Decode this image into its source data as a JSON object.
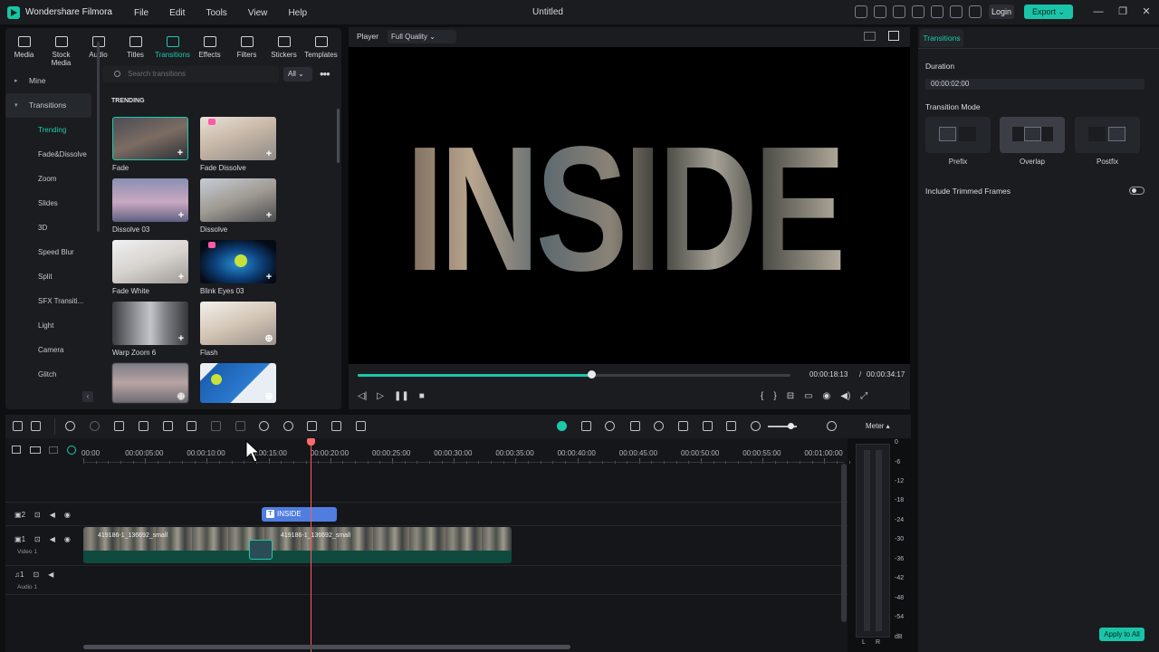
{
  "app": {
    "name": "Wondershare Filmora",
    "window_title": "Untitled",
    "login": "Login",
    "export": "Export"
  },
  "menu": [
    "File",
    "Edit",
    "Tools",
    "View",
    "Help"
  ],
  "media_tabs": [
    {
      "label": "Media",
      "icon": "media-icon"
    },
    {
      "label": "Stock Media",
      "icon": "stock-media-icon"
    },
    {
      "label": "Audio",
      "icon": "audio-icon"
    },
    {
      "label": "Titles",
      "icon": "titles-icon"
    },
    {
      "label": "Transitions",
      "icon": "transitions-icon",
      "active": true
    },
    {
      "label": "Effects",
      "icon": "effects-icon"
    },
    {
      "label": "Filters",
      "icon": "filters-icon"
    },
    {
      "label": "Stickers",
      "icon": "stickers-icon"
    },
    {
      "label": "Templates",
      "icon": "templates-icon"
    }
  ],
  "sidebar": {
    "mine": "Mine",
    "transitions": "Transitions",
    "items": [
      "Trending",
      "Fade&Dissolve",
      "Zoom",
      "Slides",
      "3D",
      "Speed Blur",
      "Split",
      "SFX Transiti...",
      "Light",
      "Camera",
      "Glitch"
    ]
  },
  "search": {
    "placeholder": "Search transitions",
    "filter": "All"
  },
  "section_title": "TRENDING",
  "transitions": [
    {
      "label": "Fade"
    },
    {
      "label": "Fade Dissolve"
    },
    {
      "label": "Dissolve 03"
    },
    {
      "label": "Dissolve"
    },
    {
      "label": "Fade White"
    },
    {
      "label": "Blink Eyes 03"
    },
    {
      "label": "Warp Zoom 6"
    },
    {
      "label": "Flash"
    },
    {
      "label": ""
    },
    {
      "label": ""
    }
  ],
  "player": {
    "label": "Player",
    "quality": "Full Quality",
    "preview_text": "INSIDE",
    "current_time": "00:00:18:13",
    "separator": "/",
    "total_time": "00:00:34:17",
    "progress": 0.54
  },
  "inspector": {
    "tab": "Transitions",
    "duration_label": "Duration",
    "duration_value": "00:00:02:00",
    "mode_label": "Transition Mode",
    "modes": [
      "Prefix",
      "Overlap",
      "Postfix"
    ],
    "selected_mode": "Overlap",
    "trimmed_label": "Include Trimmed Frames",
    "apply_all": "Apply to All"
  },
  "timeline": {
    "ruler": [
      "00:00",
      "00:00:05:00",
      "00:00:10:00",
      "00:00:15:00",
      "00:00:20:00",
      "00:00:25:00",
      "00:00:30:00",
      "00:00:35:00",
      "00:00:40:00",
      "00:00:45:00",
      "00:00:50:00",
      "00:00:55:00",
      "00:01:00:00"
    ],
    "title_clip": "INSIDE",
    "clip1": "419186-1_136692_small",
    "clip2": "419186-1_136692_small",
    "video_track": "Video 1",
    "audio_track": "Audio 1",
    "track_num_2": "2",
    "track_num_1": "1",
    "audio_num": "1"
  },
  "meter": {
    "label": "Meter ▴",
    "scale": [
      "0",
      "-6",
      "-12",
      "-18",
      "-24",
      "-30",
      "-36",
      "-42",
      "-48",
      "-54",
      "dB"
    ],
    "l": "L",
    "r": "R"
  }
}
